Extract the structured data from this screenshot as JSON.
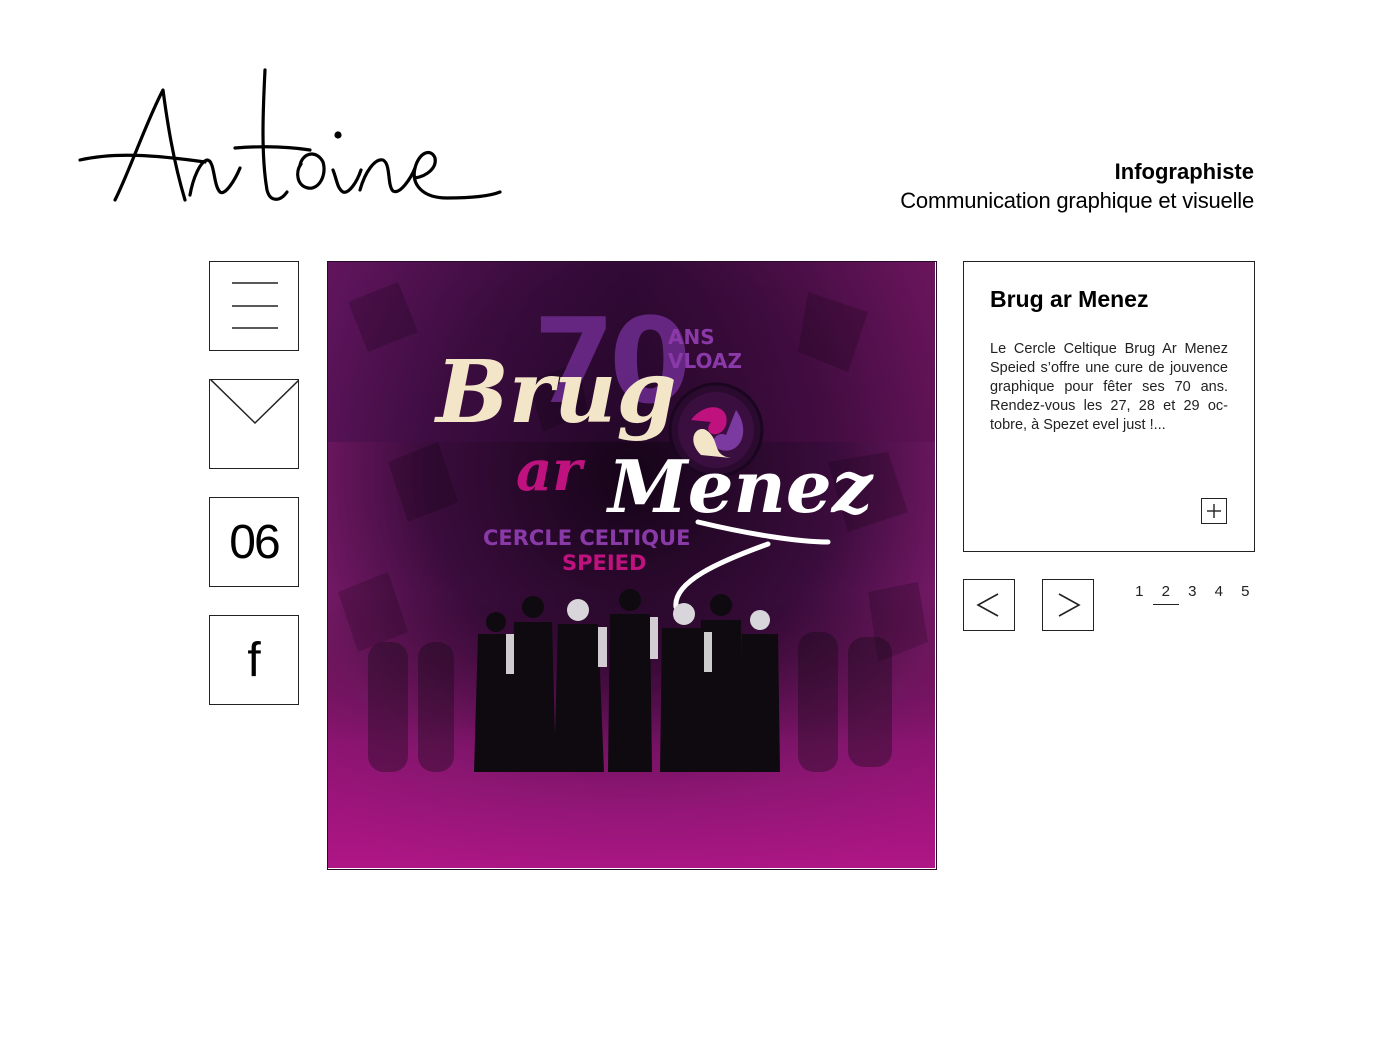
{
  "header": {
    "logo_text": "Antoine",
    "role": "Infographiste",
    "subtitle": "Communication graphique et visuelle"
  },
  "sidebar": {
    "phone_label": "06",
    "facebook_label": "f"
  },
  "poster": {
    "number": "70",
    "ans": "ANS",
    "vloaz": "VLOAZ",
    "brug": "Brug",
    "ar": "ar",
    "menez": "Menez",
    "cercle": "CERCLE CELTIQUE",
    "speied": "SPEIED"
  },
  "card": {
    "title": "Brug ar Menez",
    "description": "Le Cercle Celtique Brug Ar Menez Speied s’offre une cure de jouvence graphique pour fêter ses 70 ans. Rendez-vous les 27, 28 et 29 oc­tobre, à Spezet evel just !..."
  },
  "pagination": {
    "pages": [
      "1",
      "2",
      "3",
      "4",
      "5"
    ],
    "active_index": 1
  },
  "colors": {
    "border": "#222222",
    "poster_dark": "#1a0620",
    "poster_magenta": "#c0127e",
    "poster_purple": "#6a2a8a",
    "poster_cream": "#f3e6c8"
  }
}
